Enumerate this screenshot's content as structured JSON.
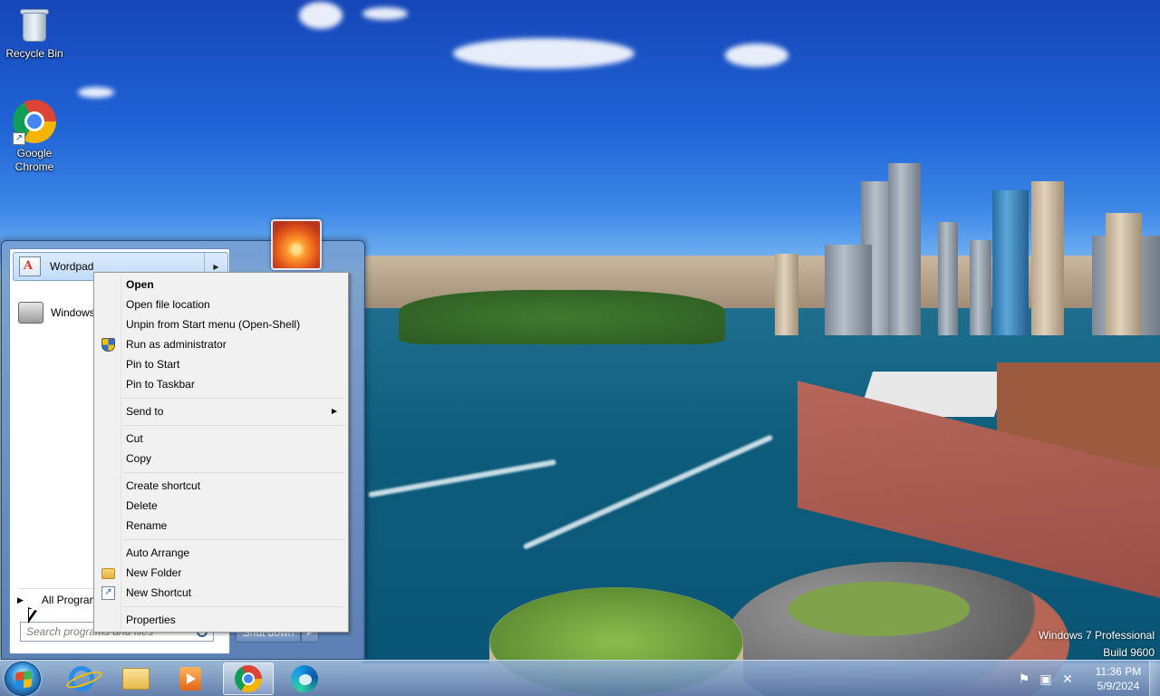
{
  "desktop": {
    "icons": [
      {
        "label": "Recycle Bin",
        "icon": "recycle-bin-icon"
      },
      {
        "label": "Google\nChrome",
        "icon": "chrome-icon"
      }
    ],
    "watermark": {
      "line1": "Windows 7 Professional",
      "line2": "Build 9600"
    }
  },
  "start_menu": {
    "pinned_item": {
      "label": "Wordpad",
      "icon": "wordpad-icon"
    },
    "recent_item": {
      "label": "Windows F",
      "icon": "fax-scan-icon"
    },
    "all_programs": "All Programs",
    "search_placeholder": "Search programs and files",
    "shutdown_label": "Shut down"
  },
  "context_menu": {
    "items": [
      {
        "label": "Open",
        "default": true
      },
      {
        "label": "Open file location"
      },
      {
        "label": "Unpin from Start menu (Open-Shell)"
      },
      {
        "label": "Run as administrator",
        "icon": "uac-shield-icon"
      },
      {
        "label": "Pin to Start"
      },
      {
        "label": "Pin to Taskbar"
      },
      {
        "label": "Send to",
        "submenu": true
      },
      {
        "label": "Cut"
      },
      {
        "label": "Copy"
      },
      {
        "label": "Create shortcut"
      },
      {
        "label": "Delete"
      },
      {
        "label": "Rename"
      },
      {
        "label": "Auto Arrange"
      },
      {
        "label": "New Folder",
        "icon": "folder-icon"
      },
      {
        "label": "New Shortcut",
        "icon": "shortcut-icon"
      },
      {
        "label": "Properties"
      }
    ]
  },
  "taskbar": {
    "pinned": [
      "internet-explorer-icon",
      "file-explorer-icon",
      "media-player-icon",
      "chrome-icon",
      "edge-icon"
    ],
    "active": "chrome-icon",
    "tray": [
      "action-center-flag-icon",
      "network-icon",
      "volume-muted-icon"
    ],
    "clock": {
      "time": "11:36 PM",
      "date": "5/9/2024"
    }
  }
}
